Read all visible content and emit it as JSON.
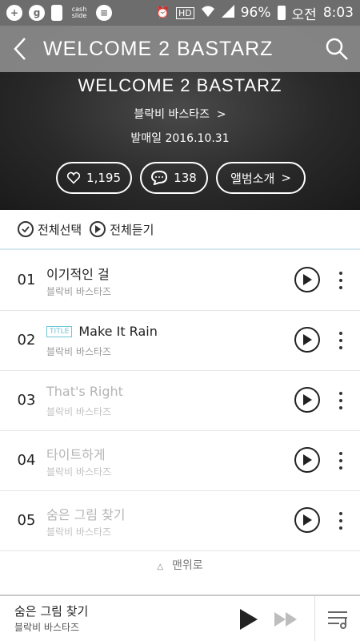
{
  "status_bar": {
    "battery": "96%",
    "ampm": "오전",
    "time": "8:03",
    "cash_slide": "cash slide",
    "hd": "HD"
  },
  "top_bar": {
    "title": "WELCOME 2 BASTARZ"
  },
  "album": {
    "title": "WELCOME 2 BASTARZ",
    "artist": "블락비 바스타즈",
    "release_label": "발매일",
    "release_date": "2016.10.31",
    "likes": "1,195",
    "comments": "138",
    "intro_label": "앨범소개"
  },
  "actions": {
    "select_all": "전체선택",
    "play_all": "전체듣기"
  },
  "tracks": [
    {
      "num": "01",
      "title": "이기적인 걸",
      "artist": "블락비 바스타즈",
      "badge": "",
      "dim": false
    },
    {
      "num": "02",
      "title": "Make It Rain",
      "artist": "블락비 바스타즈",
      "badge": "TITLE",
      "dim": false
    },
    {
      "num": "03",
      "title": "That's Right",
      "artist": "블락비 바스타즈",
      "badge": "",
      "dim": true
    },
    {
      "num": "04",
      "title": "타이트하게",
      "artist": "블락비 바스타즈",
      "badge": "",
      "dim": true
    },
    {
      "num": "05",
      "title": "숨은 그림 찾기",
      "artist": "블락비 바스타즈",
      "badge": "",
      "dim": true
    }
  ],
  "scroll_top": "맨위로",
  "now_playing": {
    "title": "숨은 그림 찾기",
    "artist": "블락비 바스타즈"
  },
  "colors": {
    "title_badge": "#6fc6d4",
    "top_bar": "#8c8c8c",
    "status_bar": "#6d6d6d"
  }
}
